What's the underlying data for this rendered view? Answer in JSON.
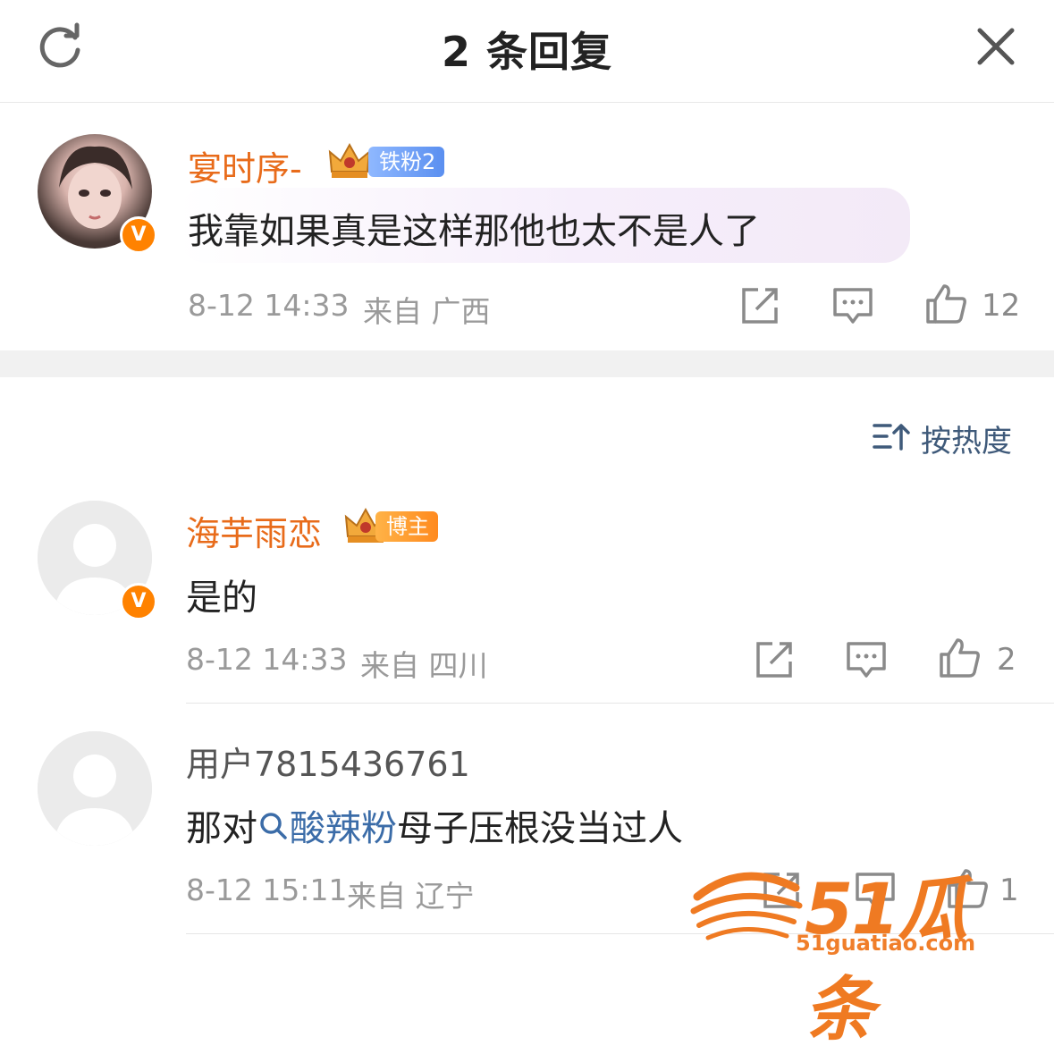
{
  "header": {
    "title": "2 条回复"
  },
  "main_comment": {
    "username": "宴时序-",
    "fan_badge": "铁粉2",
    "text": "我靠如果真是这样那他也太不是人了",
    "date": "8-12 14:33",
    "location": "来自 广西",
    "likes": "12"
  },
  "sort": {
    "label": "按热度"
  },
  "replies": [
    {
      "username": "海芋雨恋",
      "badge": "博主",
      "text": "是的",
      "date": "8-12 14:33",
      "location": "来自 四川",
      "likes": "2"
    },
    {
      "username": "用户7815436761",
      "text_before": "那对",
      "search_term": "酸辣粉",
      "text_after": "母子压根没当过人",
      "date": "8-12 15:11",
      "location": "来自 辽宁",
      "likes": "1"
    }
  ],
  "watermark": {
    "brand": "51瓜条",
    "domain": "51guatiao.com"
  },
  "colors": {
    "username_orange": "#e86b1a",
    "verified_orange": "#ff8200",
    "link_blue": "#3b6ca8",
    "meta_gray": "#9a9a9a"
  },
  "icons": {
    "refresh": "refresh-icon",
    "close": "close-icon",
    "share": "share-icon",
    "comment": "comment-icon",
    "like": "like-icon",
    "sort": "sort-icon",
    "search": "search-icon"
  }
}
